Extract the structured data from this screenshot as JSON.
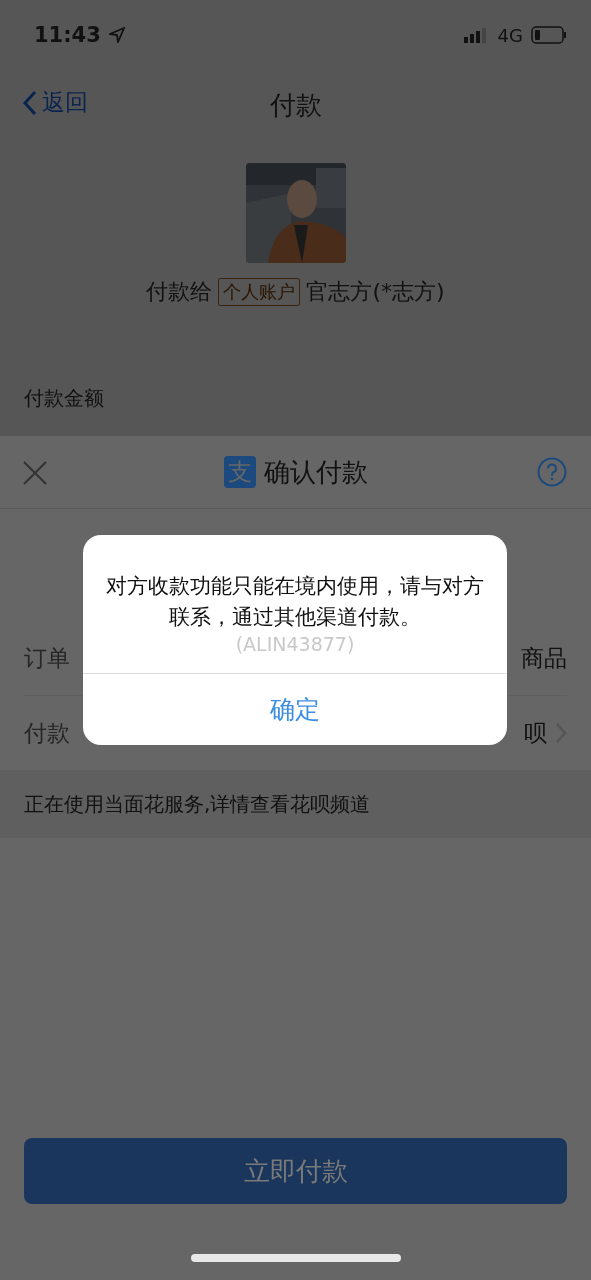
{
  "status_bar": {
    "time": "11:43",
    "network": "4G"
  },
  "nav": {
    "back": "返回",
    "title": "付款"
  },
  "payee": {
    "prefix": "付款给",
    "tag": "个人账户",
    "name": "官志方(*志方)"
  },
  "amount_label": "付款金额",
  "sheet": {
    "logo": "支",
    "title": "确认付款",
    "rows": [
      {
        "label": "订单",
        "value": "商品",
        "chevron": false
      },
      {
        "label": "付款",
        "value": "呗",
        "chevron": true
      }
    ],
    "notice": "正在使用当面花服务,详情查看花呗频道",
    "pay_button": {
      "label": "立即付款",
      "disabled": true
    }
  },
  "dialog": {
    "message": "对方收款功能只能在境内使用，请与对方联系，通过其他渠道付款。",
    "code": "(ALIN43877)",
    "button": "确定"
  }
}
